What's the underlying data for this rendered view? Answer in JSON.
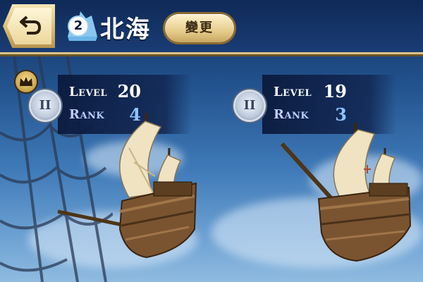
{
  "header": {
    "back_icon": "return-arrow-icon",
    "sea_number": "2",
    "sea_name": "北海",
    "change_label": "變更"
  },
  "ships": [
    {
      "level_label": "Level",
      "level": "20",
      "rank_label": "Rank",
      "rank": "4",
      "emblem": "II"
    },
    {
      "level_label": "Level",
      "level": "19",
      "rank_label": "Rank",
      "rank": "3",
      "emblem": "II"
    }
  ],
  "icons": [
    "return-arrow-icon",
    "crown-icon",
    "rank-emblem-icon",
    "sea-badge-icon"
  ],
  "colors": {
    "header_bg": "#14305f",
    "gold": "#d8c48a",
    "rank_value": "#8fc4ff"
  }
}
